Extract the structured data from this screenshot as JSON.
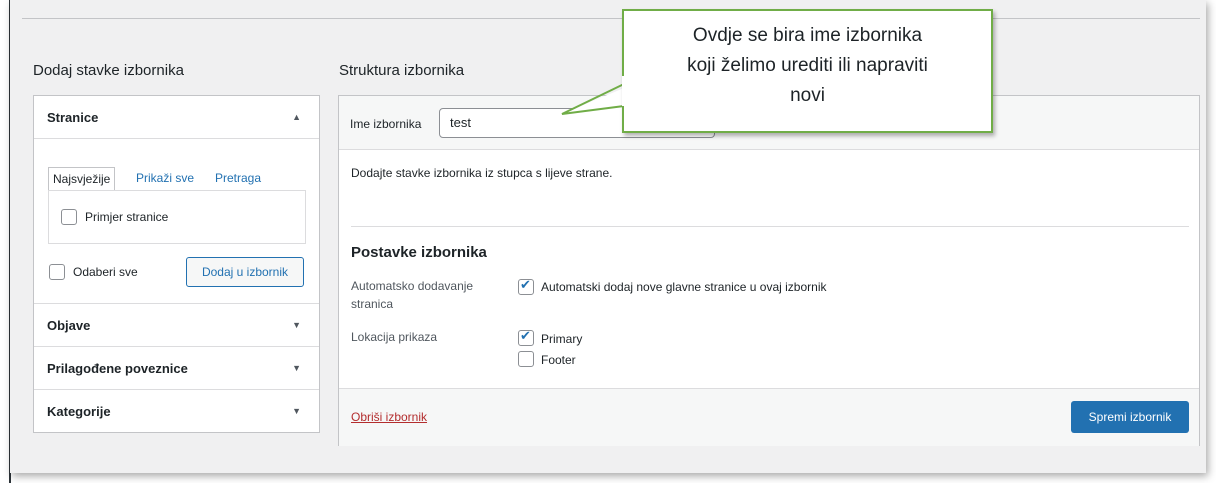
{
  "left": {
    "heading": "Dodaj stavke izbornika",
    "sections": [
      {
        "title": "Stranice",
        "arrow": "▲"
      },
      {
        "title": "Objave",
        "arrow": "▼"
      },
      {
        "title": "Prilagođene poveznice",
        "arrow": "▼"
      },
      {
        "title": "Kategorije",
        "arrow": "▼"
      }
    ],
    "tabs": [
      "Najsvježije",
      "Prikaži sve",
      "Pretraga"
    ],
    "page_item": "Primjer stranice",
    "select_all": "Odaberi sve",
    "add_button": "Dodaj u izbornik"
  },
  "right": {
    "heading": "Struktura izbornika",
    "name_label": "Ime izbornika",
    "name_value": "test",
    "instructions": "Dodajte stavke izbornika iz stupca s lijeve strane.",
    "settings_heading": "Postavke izbornika",
    "auto_add_label_line1": "Automatsko dodavanje",
    "auto_add_label_line2": "stranica",
    "auto_add_option": "Automatski dodaj nove glavne stranice u ovaj izbornik",
    "location_label": "Lokacija prikaza",
    "locations": [
      {
        "label": "Primary",
        "checked": true
      },
      {
        "label": "Footer",
        "checked": false
      }
    ],
    "delete_link": "Obriši izbornik",
    "save_button": "Spremi izbornik"
  },
  "callout": {
    "line1": "Ovdje se bira ime izbornika",
    "line2": "koji želimo urediti ili napraviti",
    "line3": "novi",
    "border_color": "#70ad47"
  },
  "colors": {
    "accent": "#2271b1",
    "danger": "#b32d2e",
    "background": "#f0f0f1"
  }
}
